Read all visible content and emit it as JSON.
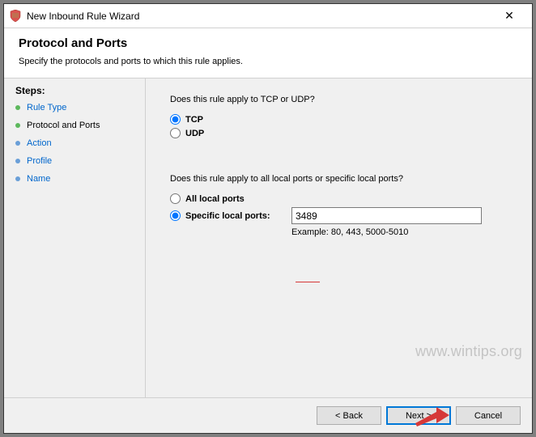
{
  "window": {
    "title": "New Inbound Rule Wizard",
    "close_glyph": "✕"
  },
  "header": {
    "title": "Protocol and Ports",
    "subtitle": "Specify the protocols and ports to which this rule applies."
  },
  "sidebar": {
    "heading": "Steps:",
    "items": [
      {
        "label": "Rule Type"
      },
      {
        "label": "Protocol and Ports"
      },
      {
        "label": "Action"
      },
      {
        "label": "Profile"
      },
      {
        "label": "Name"
      }
    ]
  },
  "content": {
    "question1": "Does this rule apply to TCP or UDP?",
    "tcp_label": "TCP",
    "udp_label": "UDP",
    "question2": "Does this rule apply to all local ports or specific local ports?",
    "all_ports_label": "All local ports",
    "specific_ports_label": "Specific local ports:",
    "port_value": "3489",
    "port_example": "Example: 80, 443, 5000-5010"
  },
  "footer": {
    "back": "< Back",
    "next": "Next >",
    "cancel": "Cancel"
  },
  "watermark": "www.wintips.org"
}
